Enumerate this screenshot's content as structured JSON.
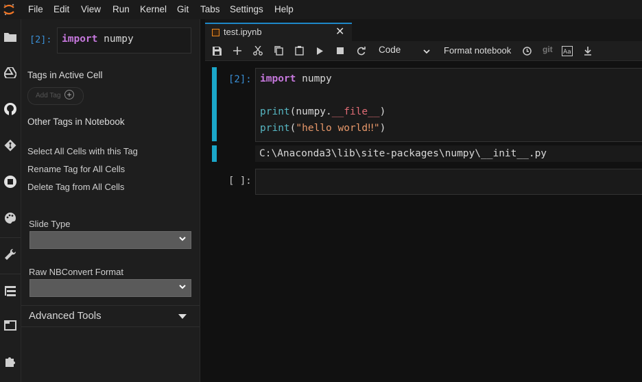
{
  "menubar": {
    "logo_icon": "jupyter-logo-icon",
    "items": [
      "File",
      "Edit",
      "View",
      "Run",
      "Kernel",
      "Git",
      "Tabs",
      "Settings",
      "Help"
    ]
  },
  "sidebar_icons": [
    "folder-icon",
    "google-drive-icon",
    "github-icon",
    "git-icon",
    "stop-circle-icon",
    "palette-icon",
    "wrench-icon",
    "table-of-contents-icon",
    "tabs-icon",
    "extension-icon"
  ],
  "property_inspector": {
    "active_cell_prompt": "[2]:",
    "active_cell_code_keyword": "import",
    "active_cell_code_rest": " numpy",
    "tags_in_active_cell": "Tags in Active Cell",
    "add_tag_label": "Add Tag",
    "other_tags": "Other Tags in Notebook",
    "select_all": "Select All Cells with this Tag",
    "rename_tag": "Rename Tag for All Cells",
    "delete_tag": "Delete Tag from All Cells",
    "slide_type_label": "Slide Type",
    "slide_type_value": "",
    "raw_nbconvert_label": "Raw NBConvert Format",
    "raw_nbconvert_value": "",
    "advanced_tools": "Advanced Tools"
  },
  "tab": {
    "name": "test.ipynb",
    "close": "✕"
  },
  "toolbar": {
    "cell_type": "Code",
    "format_notebook": "Format notebook",
    "git_label": "git"
  },
  "cells": {
    "cell1_prompt": "[2]:",
    "line1_keyword": "import",
    "line1_rest": " numpy",
    "line3_fn": "print",
    "line3_open": "(numpy.",
    "line3_dunder": "__file__",
    "line3_close": ")",
    "line4_fn": "print",
    "line4_open": "(",
    "line4_str": "\"hello world‼\"",
    "line4_close": ")",
    "output": "C:\\Anaconda3\\lib\\site-packages\\numpy\\__init__.py",
    "cell2_prompt": "[ ]:"
  },
  "colors": {
    "accent": "#1ba7c9",
    "tab_border": "#1e88c8",
    "prompt": "#3a8fd6",
    "keyword": "#c678dd",
    "string": "#e8986a"
  }
}
